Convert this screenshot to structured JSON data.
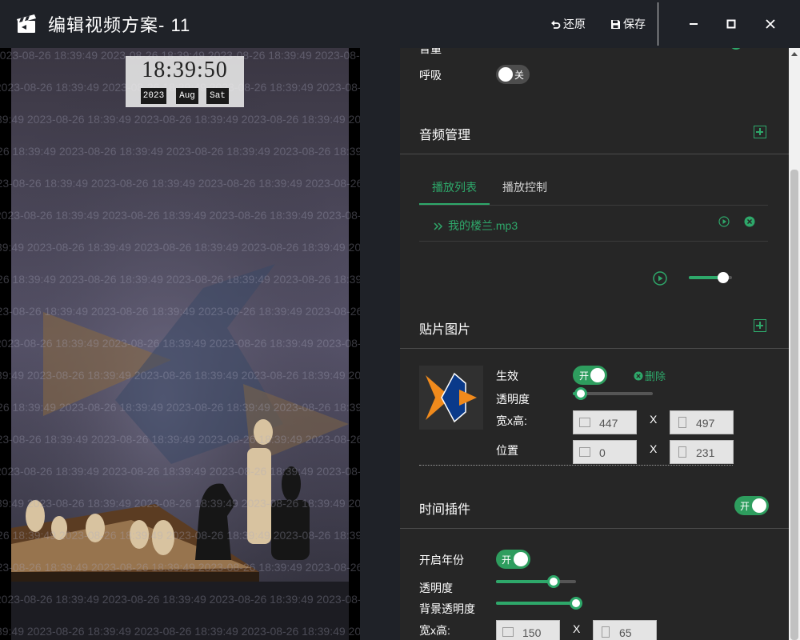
{
  "window": {
    "title": "编辑视频方案- 11",
    "restore_label": "还原",
    "save_label": "保存"
  },
  "preview": {
    "watermark_text": "2023-08-26 18:39:49",
    "clock": {
      "time": "18:39:50",
      "year": "2023",
      "month": "Aug",
      "weekday": "Sat"
    }
  },
  "panel": {
    "top_section": {
      "cut_label": "音量",
      "breath_label": "呼吸",
      "breath_toggle": "关"
    },
    "audio": {
      "title": "音频管理",
      "tabs": [
        "播放列表",
        "播放控制"
      ],
      "playlist": [
        {
          "name": "我的楼兰.mp3"
        }
      ],
      "volume": 0.8
    },
    "sticker": {
      "title": "贴片图片",
      "enable_label": "生效",
      "enable_toggle": "开",
      "delete_label": "删除",
      "opacity_label": "透明度",
      "opacity": 0.1,
      "size_label": "宽x高:",
      "width": "447",
      "height": "497",
      "pos_label": "位置",
      "x": "0",
      "y": "231",
      "x_sep": "X"
    },
    "time_plugin": {
      "title": "时间插件",
      "toggle": "开",
      "year_label": "开启年份",
      "year_toggle": "开",
      "opacity_label": "透明度",
      "opacity": 0.72,
      "bg_opacity_label": "背景透明度",
      "bg_opacity": 1.0,
      "size_label": "宽x高:",
      "width": "150",
      "height": "65",
      "x_sep": "X"
    }
  },
  "colors": {
    "accent": "#2ea86a",
    "panel_bg": "#262626",
    "title_bg": "#1f2228"
  }
}
